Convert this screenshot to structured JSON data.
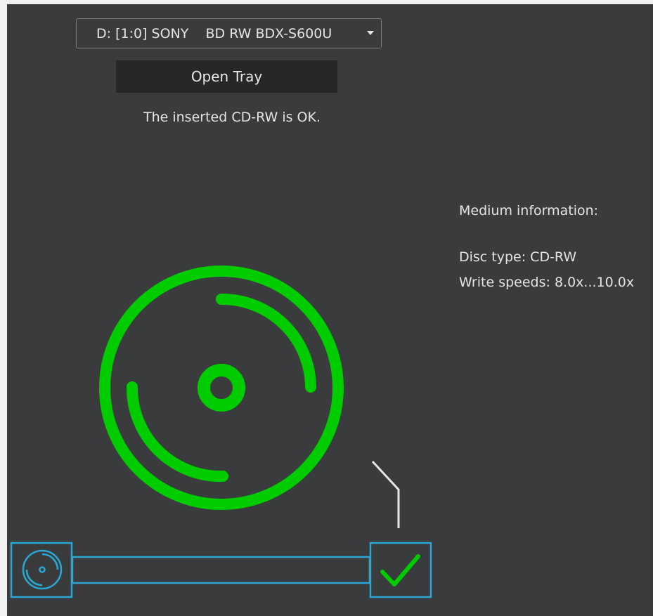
{
  "drive": {
    "selected": "D: [1:0] SONY    BD RW BDX-S600U",
    "dropdown_icon": "caret-down-icon"
  },
  "actions": {
    "open_tray_label": "Open Tray"
  },
  "status": {
    "message": "The inserted CD-RW is OK."
  },
  "medium_info": {
    "title": "Medium information:",
    "disc_type": "Disc type: CD-RW",
    "write_speeds": "Write speeds: 8.0x...10.0x"
  },
  "graphics": {
    "disc_icon": "disc-icon",
    "progress_start_icon": "disc-small-icon",
    "progress_end_icon": "checkmark-icon",
    "status_color": "#00cc00",
    "progress_color": "#2aa7d3",
    "connector_color": "#e6e6e6"
  }
}
